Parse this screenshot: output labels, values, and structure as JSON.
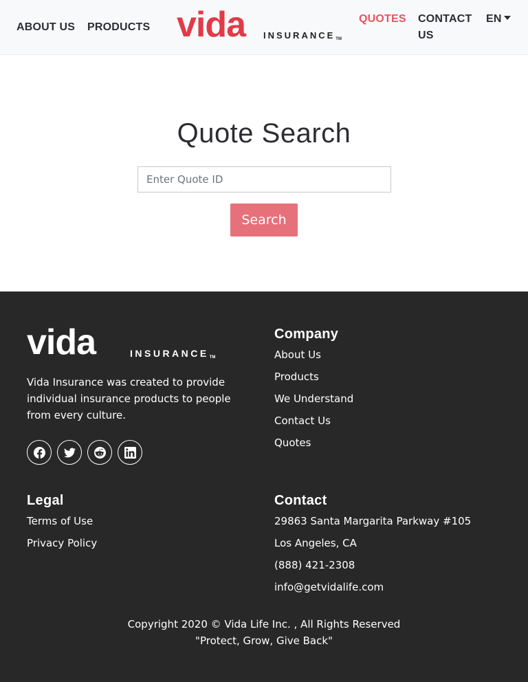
{
  "header": {
    "nav_about": "ABOUT US",
    "nav_products": "PRODUCTS",
    "nav_quotes": "QUOTES",
    "nav_contact": "CONTACT US",
    "nav_lang": "EN",
    "logo_word": "vida",
    "logo_sub": "INSURANCE",
    "logo_tm": "TM"
  },
  "main": {
    "title": "Quote Search",
    "input_placeholder": "Enter Quote ID",
    "input_value": "",
    "search_label": "Search"
  },
  "footer": {
    "logo_word": "vida",
    "logo_sub": "INSURANCE",
    "logo_tm": "TM",
    "description": "Vida Insurance was created to provide individual insurance products to people from every culture.",
    "social": [
      {
        "icon": "facebook-icon"
      },
      {
        "icon": "twitter-icon"
      },
      {
        "icon": "reddit-icon"
      },
      {
        "icon": "linkedin-icon"
      }
    ],
    "company": {
      "heading": "Company",
      "links": [
        "About Us",
        "Products",
        "We Understand",
        "Contact Us",
        "Quotes"
      ]
    },
    "legal": {
      "heading": "Legal",
      "links": [
        "Terms of Use",
        "Privacy Policy"
      ]
    },
    "contact": {
      "heading": "Contact",
      "address_line1": "29863 Santa Margarita Parkway #105",
      "address_line2": "Los Angeles, CA",
      "phone": "(888) 421-2308",
      "email": "info@getvidalife.com"
    },
    "copyright": "Copyright 2020 © Vida Life Inc. , All Rights Reserved",
    "tagline": "\"Protect, Grow, Give Back\""
  },
  "colors": {
    "brand_red": "#e23a47",
    "active_nav": "#e85460",
    "button_bg": "#e6717a",
    "footer_bg": "#282828"
  }
}
